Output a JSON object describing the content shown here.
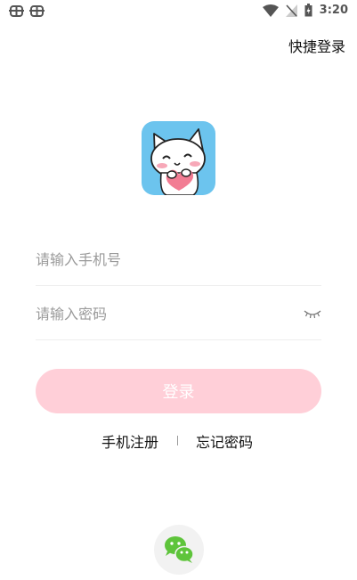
{
  "status_bar": {
    "time": "3:20",
    "icons": [
      "bug-icon",
      "bug-icon",
      "wifi-icon",
      "no-signal-icon",
      "battery-charging-icon"
    ]
  },
  "header": {
    "quick_login": "快捷登录"
  },
  "form": {
    "phone_placeholder": "请输入手机号",
    "password_placeholder": "请输入密码",
    "login_label": "登录"
  },
  "links": {
    "register": "手机注册",
    "separator": "|",
    "forgot": "忘记密码"
  },
  "social": {
    "icons": [
      "wechat-icon"
    ]
  },
  "colors": {
    "logo_bg": "#6cc4ee",
    "button_bg": "#ffcfd8",
    "wechat_green": "#5ec43b"
  }
}
